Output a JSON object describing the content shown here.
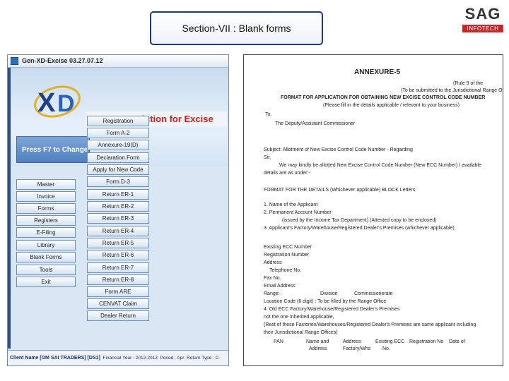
{
  "banner": {
    "title": "Section-VII : Blank forms"
  },
  "logo": {
    "main": "SAG",
    "sub": "INFOTECH"
  },
  "app": {
    "title": "Gen-XD-Excise 03.27.07.12",
    "tagline": "An A to Z solution for Excise",
    "f7_prompt": "Press F7 to Change",
    "left_menu": [
      "Master",
      "Invoice",
      "Forms",
      "Registers",
      "E-Filing",
      "Library",
      "Blank Forms",
      "Tools",
      "Exit"
    ],
    "right_menu": [
      "Registration",
      "Form A-2",
      "Annexure-19(D)",
      "Declaration Form",
      "Apply for New Code",
      "Form D-3",
      "Return ER-1",
      "Return ER-2",
      "Return ER-3",
      "Return ER-4",
      "Return ER-5",
      "Return ER-6",
      "Return ER-7",
      "Return ER-8",
      "Form ARE",
      "CENVAT Claim",
      "Dealer Return"
    ],
    "status": {
      "client_label": "Client Name",
      "client_value": "[OM SAI TRADERS] [DS1]",
      "financial_year": "Financial Year : 2012-2013",
      "period": "Period : Apr",
      "return_type": "Return Type : C"
    }
  },
  "document": {
    "title": "ANNEXURE-5",
    "lines": [
      "(Rule 9 of the",
      "(To be submitted to the Jurisdictional Range Office)",
      "FORMAT FOR APPLICATION FOR OBTAINING NEW EXCISE CONTROL CODE NUMBER",
      "(Please fill in the details applicable / relevant to your business)",
      "To,",
      "The Deputy/Assistant Commissioner",
      "Subject: Allotment of New Excise Control Code Number - Regarding",
      "Sir,",
      "We may kindly be allotted New Excise Control Code Number (New ECC Number) / available",
      "details are as under:-",
      "FORMAT FOR THE DETAILS (Whichever applicable) BLOCK Letters",
      "1. Name of the Applicant",
      "2. Permanent Account Number",
      "(issued by the Income Tax Department) (Attested copy to be enclosed)",
      "3. Applicant's Factory/Warehouse/Registered Dealer's Premises (whichever applicable)",
      "Existing ECC Number",
      "Registration Number",
      "Address",
      "Telephone No.",
      "Fax No.",
      "Email Address",
      "Range:",
      "Location Code (6 digit) : To be filled by the Range Office",
      "4. Old ECC Factory/Warehouse/Registered Dealer's Premises",
      "not the one Inherited applicable,",
      "(Rest of these Factories/Warehouses/Registered Dealer's Premises are same applicant including",
      "their Jurisdictional Range Offices)",
      "PAN",
      "Name and",
      "Address",
      "Division",
      "Commissionerate",
      "Address",
      "Factory/Whs",
      "Existing ECC",
      "No.",
      "Registration No",
      "Date of"
    ]
  }
}
